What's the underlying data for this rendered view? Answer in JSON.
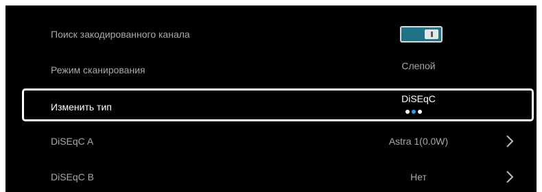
{
  "rows": [
    {
      "label": "Поиск закодированного канала"
    },
    {
      "label": "Режим сканирования",
      "value": "Слепой"
    },
    {
      "label": "Изменить тип",
      "value": "DiSEqC"
    },
    {
      "label": "DiSEqC A",
      "value": "Astra 1(0.0W)"
    },
    {
      "label": "DiSEqC B",
      "value": "Нет"
    }
  ],
  "toggle": {
    "state": "on"
  },
  "pager": {
    "count": 3,
    "active_index": 1
  },
  "colors": {
    "background": "#000000",
    "accent": "#1e7387",
    "active_dot": "#2aa3e8"
  }
}
